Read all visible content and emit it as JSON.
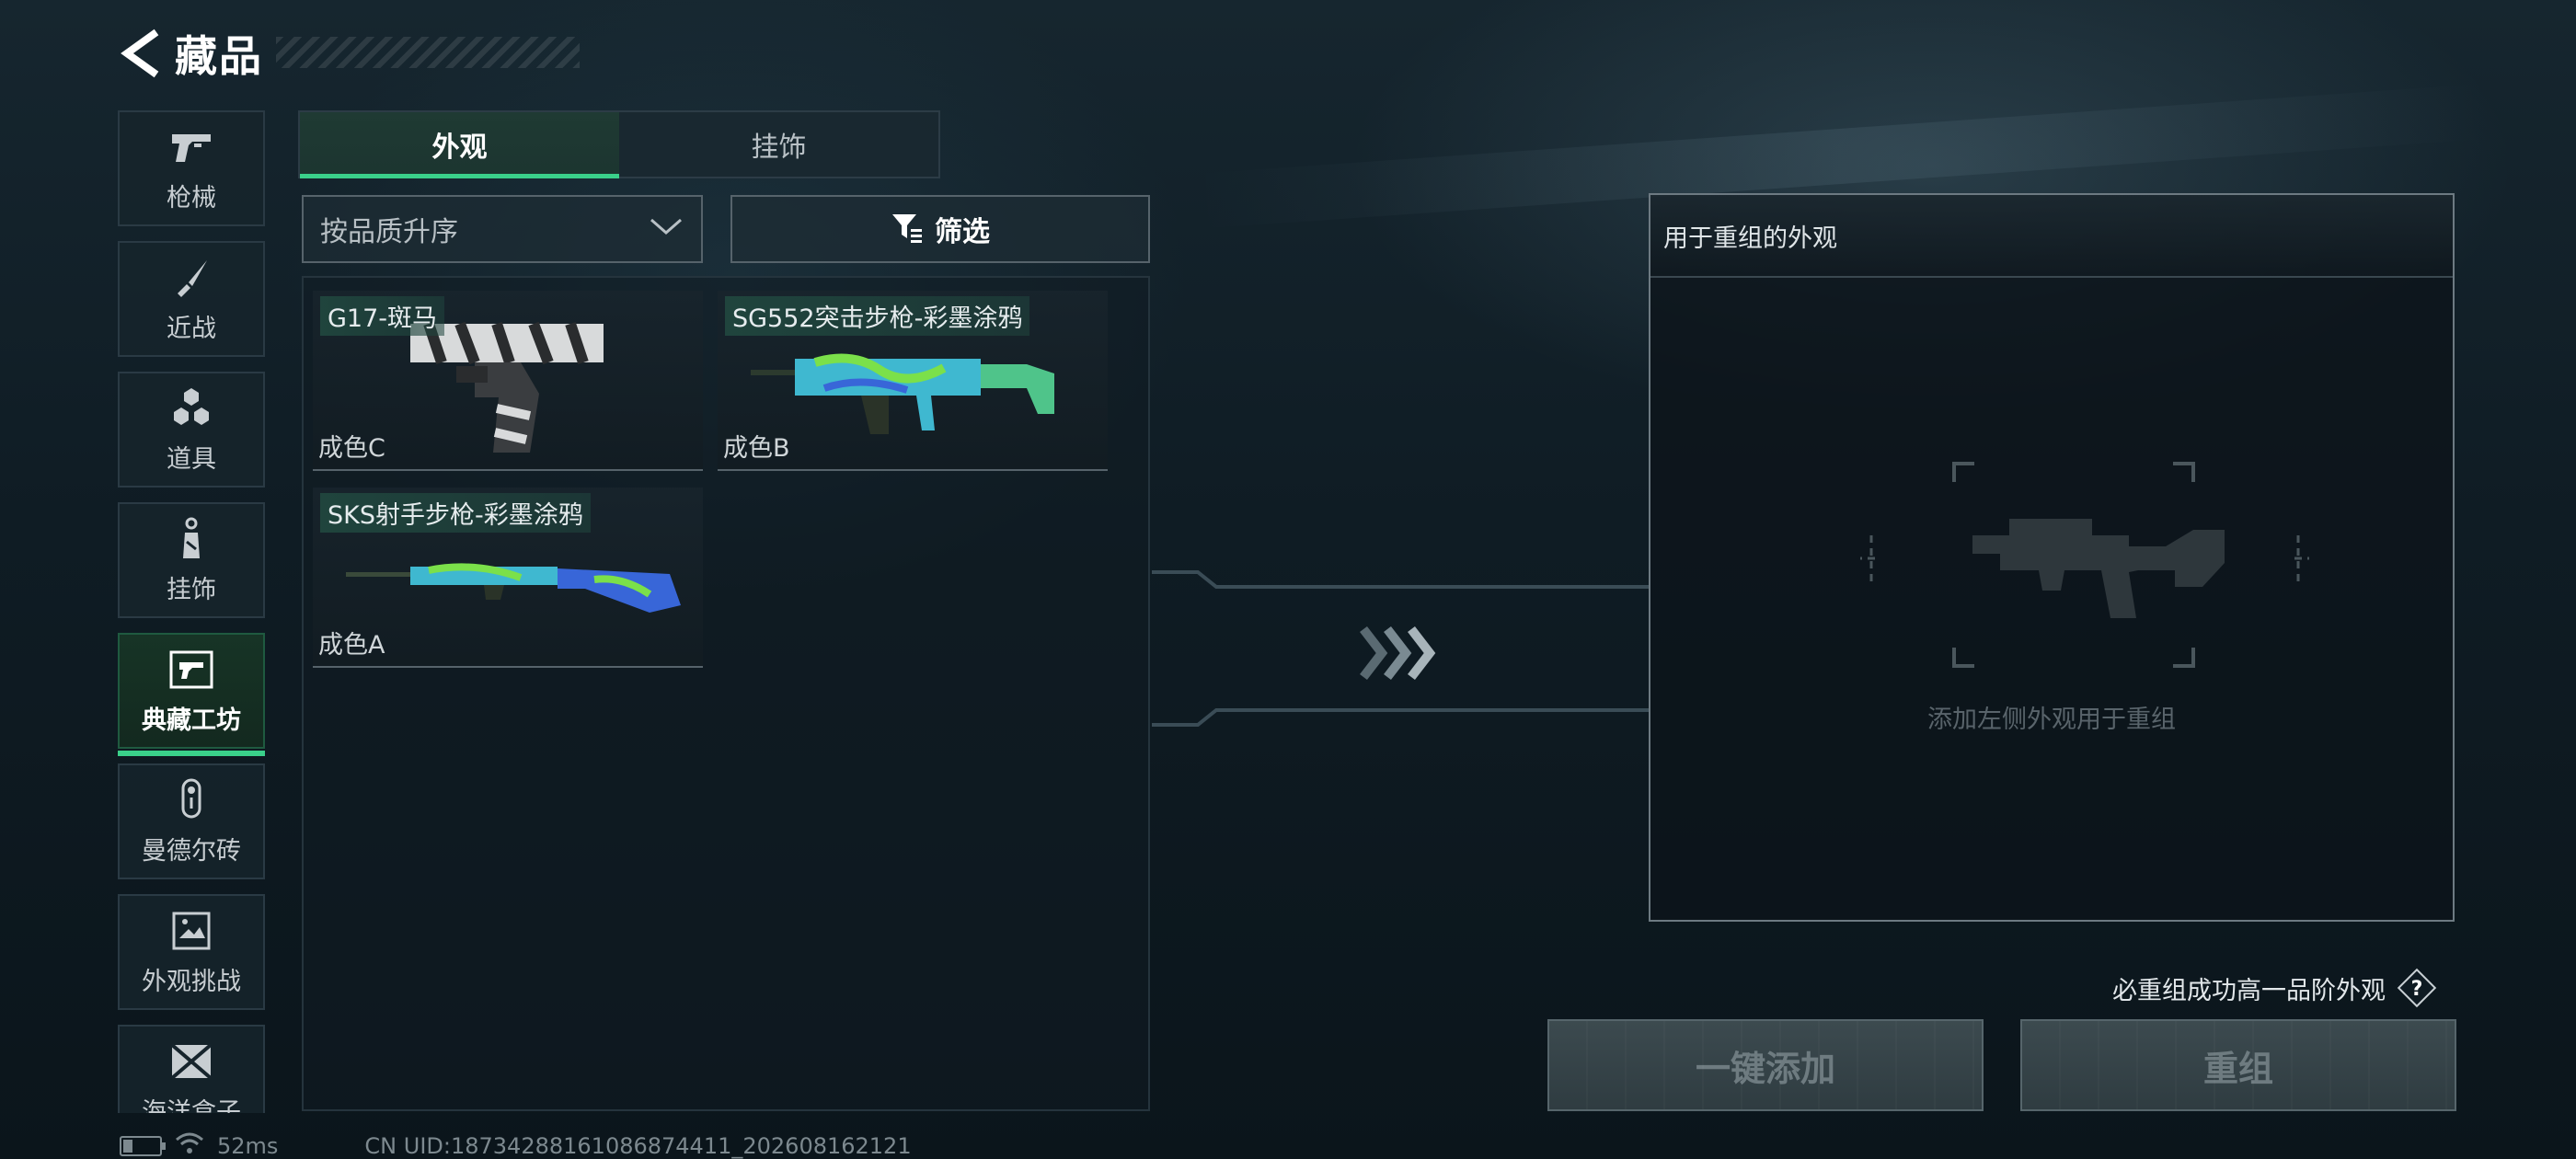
{
  "header": {
    "title": "藏品",
    "back_icon": "back-arrow-icon"
  },
  "sidebar": {
    "items": [
      {
        "label": "枪械",
        "icon": "pistol-icon",
        "active": false
      },
      {
        "label": "近战",
        "icon": "knife-icon",
        "active": false
      },
      {
        "label": "道具",
        "icon": "hexagon-cluster-icon",
        "active": false
      },
      {
        "label": "挂饰",
        "icon": "charm-tag-icon",
        "active": false
      },
      {
        "label": "典藏工坊",
        "icon": "workshop-icon",
        "active": true
      },
      {
        "label": "曼德尔砖",
        "icon": "capsule-key-icon",
        "active": false
      },
      {
        "label": "外观挑战",
        "icon": "challenge-image-icon",
        "active": false
      },
      {
        "label": "海洋盒子",
        "icon": "crate-icon",
        "active": false
      }
    ]
  },
  "tabs": [
    {
      "label": "外观",
      "active": true
    },
    {
      "label": "挂饰",
      "active": false
    }
  ],
  "sort": {
    "value": "按品质升序"
  },
  "filter": {
    "label": "筛选"
  },
  "items": [
    {
      "name": "G17-斑马",
      "grade": "成色C"
    },
    {
      "name": "SG552突击步枪-彩墨涂鸦",
      "grade": "成色B"
    },
    {
      "name": "SKS射手步枪-彩墨涂鸦",
      "grade": "成色A"
    }
  ],
  "recombine": {
    "title": "用于重组的外观",
    "placeholder": "添加左侧外观用于重组"
  },
  "guarantee": {
    "text": "必重组成功高一品阶外观",
    "help": "?"
  },
  "actions": {
    "add_all": "一键添加",
    "recombine": "重组"
  },
  "status": {
    "ping": "52ms",
    "uid": "CN UID:18734288161086874411_202608162121"
  },
  "colors": {
    "accent": "#3ad08a",
    "panel_border": "#6d7a82",
    "disabled_text": "#6e7b80"
  }
}
